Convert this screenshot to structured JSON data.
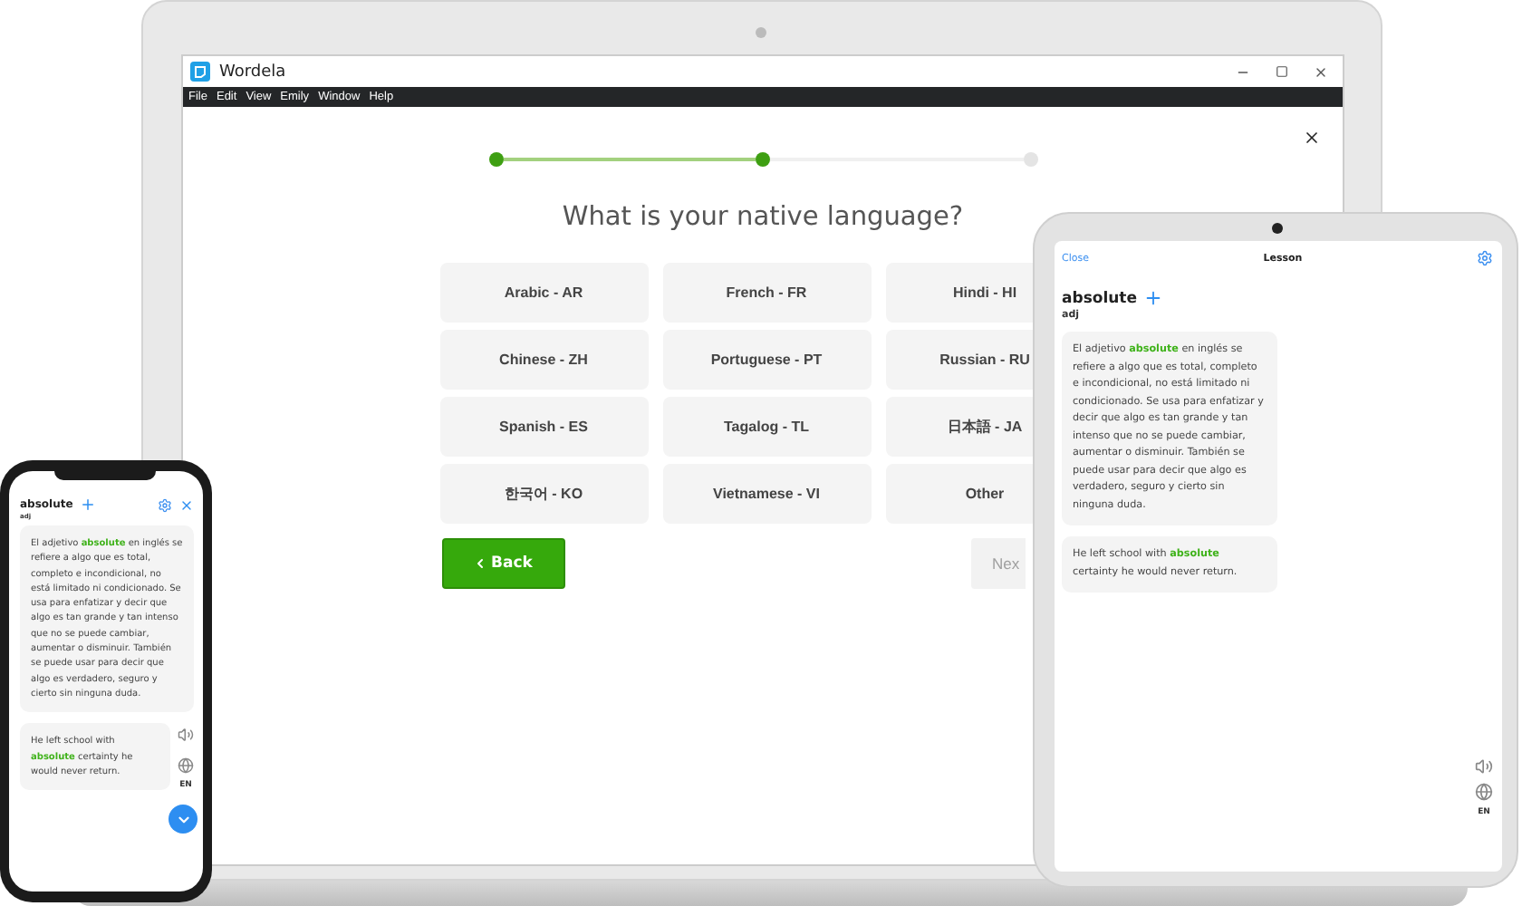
{
  "laptop": {
    "window": {
      "title": "Wordela"
    },
    "menu": [
      "File",
      "Edit",
      "View",
      "Emily",
      "Window",
      "Help"
    ],
    "progress": [
      {
        "done": true
      },
      {
        "done": true
      },
      {
        "done": false
      }
    ],
    "question": "What is your native language?",
    "languages": [
      "Arabic - AR",
      "French - FR",
      "Hindi - HI",
      "Chinese - ZH",
      "Portuguese - PT",
      "Russian - RU",
      "Spanish - ES",
      "Tagalog - TL",
      "日本語 - JA",
      "한국어 - KO",
      "Vietnamese - VI",
      "Other"
    ],
    "back_button": "Back",
    "next_button": "Nex"
  },
  "tablet": {
    "close": "Close",
    "title": "Lesson",
    "word": "absolute",
    "part_of_speech": "adj",
    "definition": "El adjetivo **absolute** en inglés se refiere a algo que es total, completo e incondicional, no está limitado ni condicionado. Se usa para enfatizar y decir que algo es tan grande y tan intenso que no se puede cambiar, aumentar o disminuir. También se puede usar para decir que algo es verdadero, seguro y cierto sin ninguna duda.",
    "example": "He left school with **absolute** certainty he would never return.",
    "language": "EN"
  },
  "phone": {
    "word": "absolute",
    "part_of_speech": "adj",
    "definition": "El adjetivo **absolute** en inglés se refiere a algo que es total, completo e incondicional, no está limitado ni condicionado. Se usa para enfatizar y decir que algo es tan grande y tan intenso que no se puede cambiar, aumentar o disminuir. También se puede usar para decir que algo es verdadero, seguro y cierto sin ninguna duda.",
    "example": "He left school with **absolute** certainty he would never return.",
    "language": "EN"
  }
}
